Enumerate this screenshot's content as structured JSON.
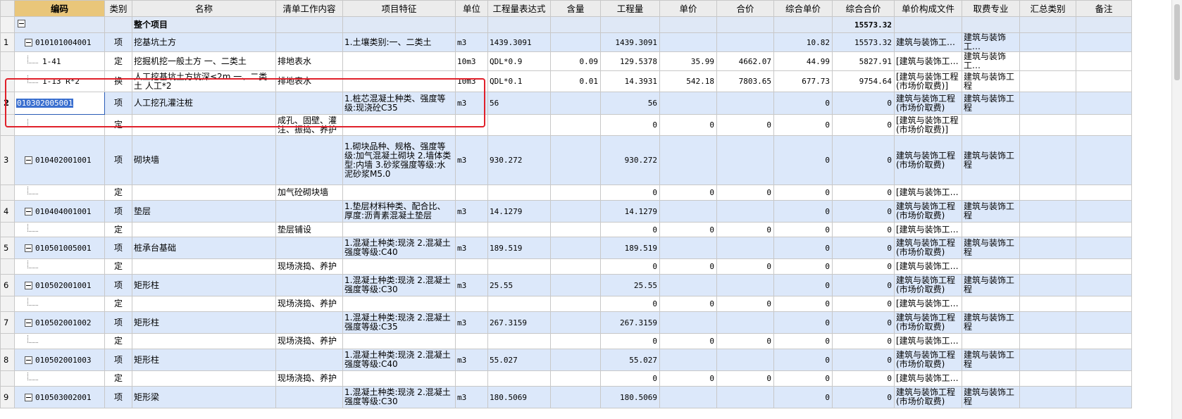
{
  "headers": [
    "",
    "编码",
    "类别",
    "名称",
    "清单工作内容",
    "项目特征",
    "单位",
    "工程量表达式",
    "含量",
    "工程量",
    "单价",
    "合价",
    "综合单价",
    "综合合价",
    "单价构成文件",
    "取费专业",
    "汇总类别",
    "备注"
  ],
  "root": {
    "name": "整个项目",
    "total": "15573.32"
  },
  "rows": [
    {
      "idx": "1",
      "code": "010101004001",
      "type": "项",
      "name": "挖基坑土方",
      "work": "",
      "feature": "1.土壤类别:一、二类土",
      "unit": "m3",
      "expr": "1439.3091",
      "content": "",
      "qty": "1439.3091",
      "price": "",
      "amount": "",
      "cprice": "10.82",
      "camount": "15573.32",
      "file": "建筑与装饰工…",
      "fee": "建筑与装饰工…",
      "kind": "qd",
      "h": 22
    },
    {
      "idx": "",
      "code": "1-41",
      "type": "定",
      "name": "挖掘机挖一般土方 一、二类土",
      "work": "排地表水",
      "feature": "",
      "unit": "10m3",
      "expr": "QDL*0.9",
      "content": "0.09",
      "qty": "129.5378",
      "price": "35.99",
      "amount": "4662.07",
      "cprice": "44.99",
      "camount": "5827.91",
      "file": "[建筑与装饰工…",
      "fee": "建筑与装饰工…",
      "kind": "de",
      "h": 22
    },
    {
      "idx": "",
      "code": "1-13 R*2",
      "type": "换",
      "name": "人工挖基坑土方坑深≤2m 一、二类土 人工*2",
      "work": "排地表水",
      "feature": "",
      "unit": "10m3",
      "expr": "QDL*0.1",
      "content": "0.01",
      "qty": "14.3931",
      "price": "542.18",
      "amount": "7803.65",
      "cprice": "677.73",
      "camount": "9754.64",
      "file": "[建筑与装饰工程(市场价取费)]",
      "fee": "建筑与装饰工程",
      "kind": "de",
      "h": 30
    },
    {
      "idx": "2",
      "code": "010302005001",
      "type": "项",
      "name": "人工挖孔灌注桩",
      "work": "",
      "feature": "1.桩芯混凝土种类、强度等级:现浇砼C35",
      "unit": "m3",
      "expr": "56",
      "content": "",
      "qty": "56",
      "price": "",
      "amount": "",
      "cprice": "0",
      "camount": "0",
      "file": "建筑与装饰工程(市场价取费)",
      "fee": "建筑与装饰工程",
      "kind": "qd",
      "h": 32,
      "current": true
    },
    {
      "idx": "",
      "code": "",
      "type": "定",
      "name": "",
      "work": "成孔、固壁、灌注、振捣、养护",
      "feature": "",
      "unit": "",
      "expr": "",
      "content": "",
      "qty": "0",
      "price": "0",
      "amount": "0",
      "cprice": "0",
      "camount": "0",
      "file": "[建筑与装饰工程(市场价取费)]",
      "fee": "",
      "kind": "de",
      "h": 30
    },
    {
      "idx": "3",
      "code": "010402001001",
      "type": "项",
      "name": "砌块墙",
      "work": "",
      "feature": "1.砌块品种、规格、强度等级:加气混凝土砌块 2.墙体类型:内墙 3.砂浆强度等级:水泥砂浆M5.0",
      "unit": "m3",
      "expr": "930.272",
      "content": "",
      "qty": "930.272",
      "price": "",
      "amount": "",
      "cprice": "0",
      "camount": "0",
      "file": "建筑与装饰工程(市场价取费)",
      "fee": "建筑与装饰工程",
      "kind": "qd",
      "h": 70
    },
    {
      "idx": "",
      "code": "",
      "type": "定",
      "name": "",
      "work": "加气砼砌块墙",
      "feature": "",
      "unit": "",
      "expr": "",
      "content": "",
      "qty": "0",
      "price": "0",
      "amount": "0",
      "cprice": "0",
      "camount": "0",
      "file": "[建筑与装饰工…",
      "fee": "",
      "kind": "de",
      "h": 22
    },
    {
      "idx": "4",
      "code": "010404001001",
      "type": "项",
      "name": "垫层",
      "work": "",
      "feature": "1.垫层材料种类、配合比、厚度:沥青素混凝土垫层",
      "unit": "m3",
      "expr": "14.1279",
      "content": "",
      "qty": "14.1279",
      "price": "",
      "amount": "",
      "cprice": "0",
      "camount": "0",
      "file": "建筑与装饰工程(市场价取费)",
      "fee": "建筑与装饰工程",
      "kind": "qd",
      "h": 31
    },
    {
      "idx": "",
      "code": "",
      "type": "定",
      "name": "",
      "work": "垫层铺设",
      "feature": "",
      "unit": "",
      "expr": "",
      "content": "",
      "qty": "0",
      "price": "0",
      "amount": "0",
      "cprice": "0",
      "camount": "0",
      "file": "[建筑与装饰工…",
      "fee": "",
      "kind": "de",
      "h": 21
    },
    {
      "idx": "5",
      "code": "010501005001",
      "type": "项",
      "name": "桩承台基础",
      "work": "",
      "feature": "1.混凝土种类:现浇 2.混凝土强度等级:C40",
      "unit": "m3",
      "expr": "189.519",
      "content": "",
      "qty": "189.519",
      "price": "",
      "amount": "",
      "cprice": "0",
      "camount": "0",
      "file": "建筑与装饰工程(市场价取费)",
      "fee": "建筑与装饰工程",
      "kind": "qd",
      "h": 31
    },
    {
      "idx": "",
      "code": "",
      "type": "定",
      "name": "",
      "work": "现场浇捣、养护",
      "feature": "",
      "unit": "",
      "expr": "",
      "content": "",
      "qty": "0",
      "price": "0",
      "amount": "0",
      "cprice": "0",
      "camount": "0",
      "file": "[建筑与装饰工…",
      "fee": "",
      "kind": "de",
      "h": 22
    },
    {
      "idx": "6",
      "code": "010502001001",
      "type": "项",
      "name": "矩形柱",
      "work": "",
      "feature": "1.混凝土种类:现浇 2.混凝土强度等级:C30",
      "unit": "m3",
      "expr": "25.55",
      "content": "",
      "qty": "25.55",
      "price": "",
      "amount": "",
      "cprice": "0",
      "camount": "0",
      "file": "建筑与装饰工程(市场价取费)",
      "fee": "建筑与装饰工程",
      "kind": "qd",
      "h": 31
    },
    {
      "idx": "",
      "code": "",
      "type": "定",
      "name": "",
      "work": "现场浇捣、养护",
      "feature": "",
      "unit": "",
      "expr": "",
      "content": "",
      "qty": "0",
      "price": "0",
      "amount": "0",
      "cprice": "0",
      "camount": "0",
      "file": "[建筑与装饰工…",
      "fee": "",
      "kind": "de",
      "h": 22
    },
    {
      "idx": "7",
      "code": "010502001002",
      "type": "项",
      "name": "矩形柱",
      "work": "",
      "feature": "1.混凝土种类:现浇 2.混凝土强度等级:C35",
      "unit": "m3",
      "expr": "267.3159",
      "content": "",
      "qty": "267.3159",
      "price": "",
      "amount": "",
      "cprice": "0",
      "camount": "0",
      "file": "建筑与装饰工程(市场价取费)",
      "fee": "建筑与装饰工程",
      "kind": "qd",
      "h": 31
    },
    {
      "idx": "",
      "code": "",
      "type": "定",
      "name": "",
      "work": "现场浇捣、养护",
      "feature": "",
      "unit": "",
      "expr": "",
      "content": "",
      "qty": "0",
      "price": "0",
      "amount": "0",
      "cprice": "0",
      "camount": "0",
      "file": "[建筑与装饰工…",
      "fee": "",
      "kind": "de",
      "h": 22
    },
    {
      "idx": "8",
      "code": "010502001003",
      "type": "项",
      "name": "矩形柱",
      "work": "",
      "feature": "1.混凝土种类:现浇 2.混凝土强度等级:C40",
      "unit": "m3",
      "expr": "55.027",
      "content": "",
      "qty": "55.027",
      "price": "",
      "amount": "",
      "cprice": "0",
      "camount": "0",
      "file": "建筑与装饰工程(市场价取费)",
      "fee": "建筑与装饰工程",
      "kind": "qd",
      "h": 31
    },
    {
      "idx": "",
      "code": "",
      "type": "定",
      "name": "",
      "work": "现场浇捣、养护",
      "feature": "",
      "unit": "",
      "expr": "",
      "content": "",
      "qty": "0",
      "price": "0",
      "amount": "0",
      "cprice": "0",
      "camount": "0",
      "file": "[建筑与装饰工…",
      "fee": "",
      "kind": "de",
      "h": 22
    },
    {
      "idx": "9",
      "code": "010503002001",
      "type": "项",
      "name": "矩形梁",
      "work": "",
      "feature": "1.混凝土种类:现浇 2.混凝土强度等级:C30",
      "unit": "m3",
      "expr": "180.5069",
      "content": "",
      "qty": "180.5069",
      "price": "",
      "amount": "",
      "cprice": "0",
      "camount": "0",
      "file": "建筑与装饰工程(市场价取费)",
      "fee": "建筑与装饰工程",
      "kind": "qd",
      "h": 31
    }
  ]
}
